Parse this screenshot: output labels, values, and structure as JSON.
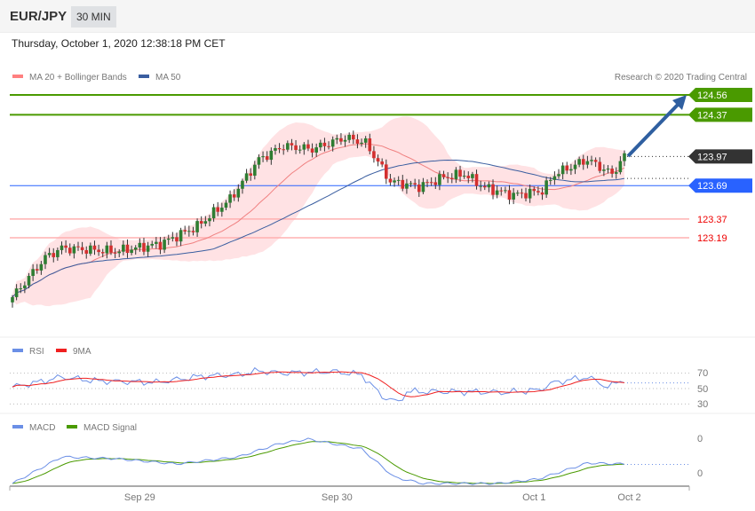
{
  "header": {
    "symbol": "EUR/JPY",
    "timeframe": "30 MIN",
    "datetime": "Thursday, October 1, 2020 12:38:18 PM CET"
  },
  "legend": {
    "ma20": "MA 20 + Bollinger Bands",
    "ma50": "MA 50",
    "rsi": "RSI",
    "rsi_ma": "9MA",
    "macd": "MACD",
    "macd_signal": "MACD Signal"
  },
  "copyright": "Research © 2020 Trading Central",
  "colors": {
    "resistance": "#4a9a00",
    "support": "#f08080",
    "pivot": "#2962ff",
    "last": "#333333",
    "ma20": "#f08080",
    "ma50": "#3a5ea0",
    "band": "#ffd6d8",
    "up": "#2e7d32",
    "down": "#d32f2f",
    "rsi": "#6b8fe6",
    "rsi_ma": "#f02020",
    "macd": "#6b8fe6",
    "signal": "#4a9a00",
    "arrow": "#2f5fa0"
  },
  "chart_data": {
    "type": "candlestick",
    "candles": 150,
    "close_anchors": [
      [
        0,
        122.62
      ],
      [
        8,
        123.0
      ],
      [
        12,
        123.09
      ],
      [
        25,
        123.06
      ],
      [
        36,
        123.13
      ],
      [
        45,
        123.3
      ],
      [
        53,
        123.56
      ],
      [
        60,
        123.94
      ],
      [
        66,
        124.07
      ],
      [
        73,
        124.04
      ],
      [
        81,
        124.15
      ],
      [
        86,
        124.1
      ],
      [
        92,
        123.73
      ],
      [
        99,
        123.68
      ],
      [
        105,
        123.77
      ],
      [
        110,
        123.8
      ],
      [
        115,
        123.67
      ],
      [
        122,
        123.6
      ],
      [
        129,
        123.64
      ],
      [
        132,
        123.8
      ],
      [
        140,
        123.94
      ],
      [
        146,
        123.8
      ],
      [
        149,
        123.97
      ]
    ],
    "levels": [
      {
        "value": 124.56,
        "label": "124.56",
        "kind": "resistance"
      },
      {
        "value": 124.37,
        "label": "124.37",
        "kind": "resistance"
      },
      {
        "value": 123.97,
        "label": "123.97",
        "kind": "last"
      },
      {
        "value": 123.69,
        "label": "123.69",
        "kind": "pivot"
      },
      {
        "value": 123.37,
        "label": "123.37",
        "kind": "support"
      },
      {
        "value": 123.19,
        "label": "123.19",
        "kind": "support"
      }
    ],
    "ylim": [
      122.45,
      124.8
    ],
    "rsi_anchors": [
      [
        0,
        52
      ],
      [
        6,
        58
      ],
      [
        12,
        65
      ],
      [
        20,
        60
      ],
      [
        35,
        58
      ],
      [
        46,
        66
      ],
      [
        55,
        68
      ],
      [
        60,
        73
      ],
      [
        65,
        70
      ],
      [
        78,
        72
      ],
      [
        85,
        68
      ],
      [
        90,
        40
      ],
      [
        94,
        32
      ],
      [
        96,
        46
      ],
      [
        110,
        46
      ],
      [
        120,
        45
      ],
      [
        128,
        48
      ],
      [
        132,
        58
      ],
      [
        140,
        65
      ],
      [
        145,
        52
      ],
      [
        149,
        62
      ]
    ],
    "rsi_ticks": [
      "70",
      "50",
      "30"
    ],
    "macd_anchors": [
      [
        0,
        -25
      ],
      [
        12,
        5
      ],
      [
        25,
        3
      ],
      [
        40,
        -3
      ],
      [
        55,
        5
      ],
      [
        65,
        20
      ],
      [
        72,
        25
      ],
      [
        85,
        14
      ],
      [
        93,
        -18
      ],
      [
        100,
        -25
      ],
      [
        118,
        -25
      ],
      [
        128,
        -20
      ],
      [
        140,
        -2
      ],
      [
        149,
        -3
      ]
    ],
    "macd_ticks": [
      "0",
      "0"
    ],
    "x_ticks": [
      {
        "index": 31,
        "label": "Sep 29"
      },
      {
        "index": 79,
        "label": "Sep 30"
      },
      {
        "index": 127,
        "label": "Oct 1"
      },
      {
        "index": 150.2,
        "label": "Oct 2"
      }
    ]
  }
}
